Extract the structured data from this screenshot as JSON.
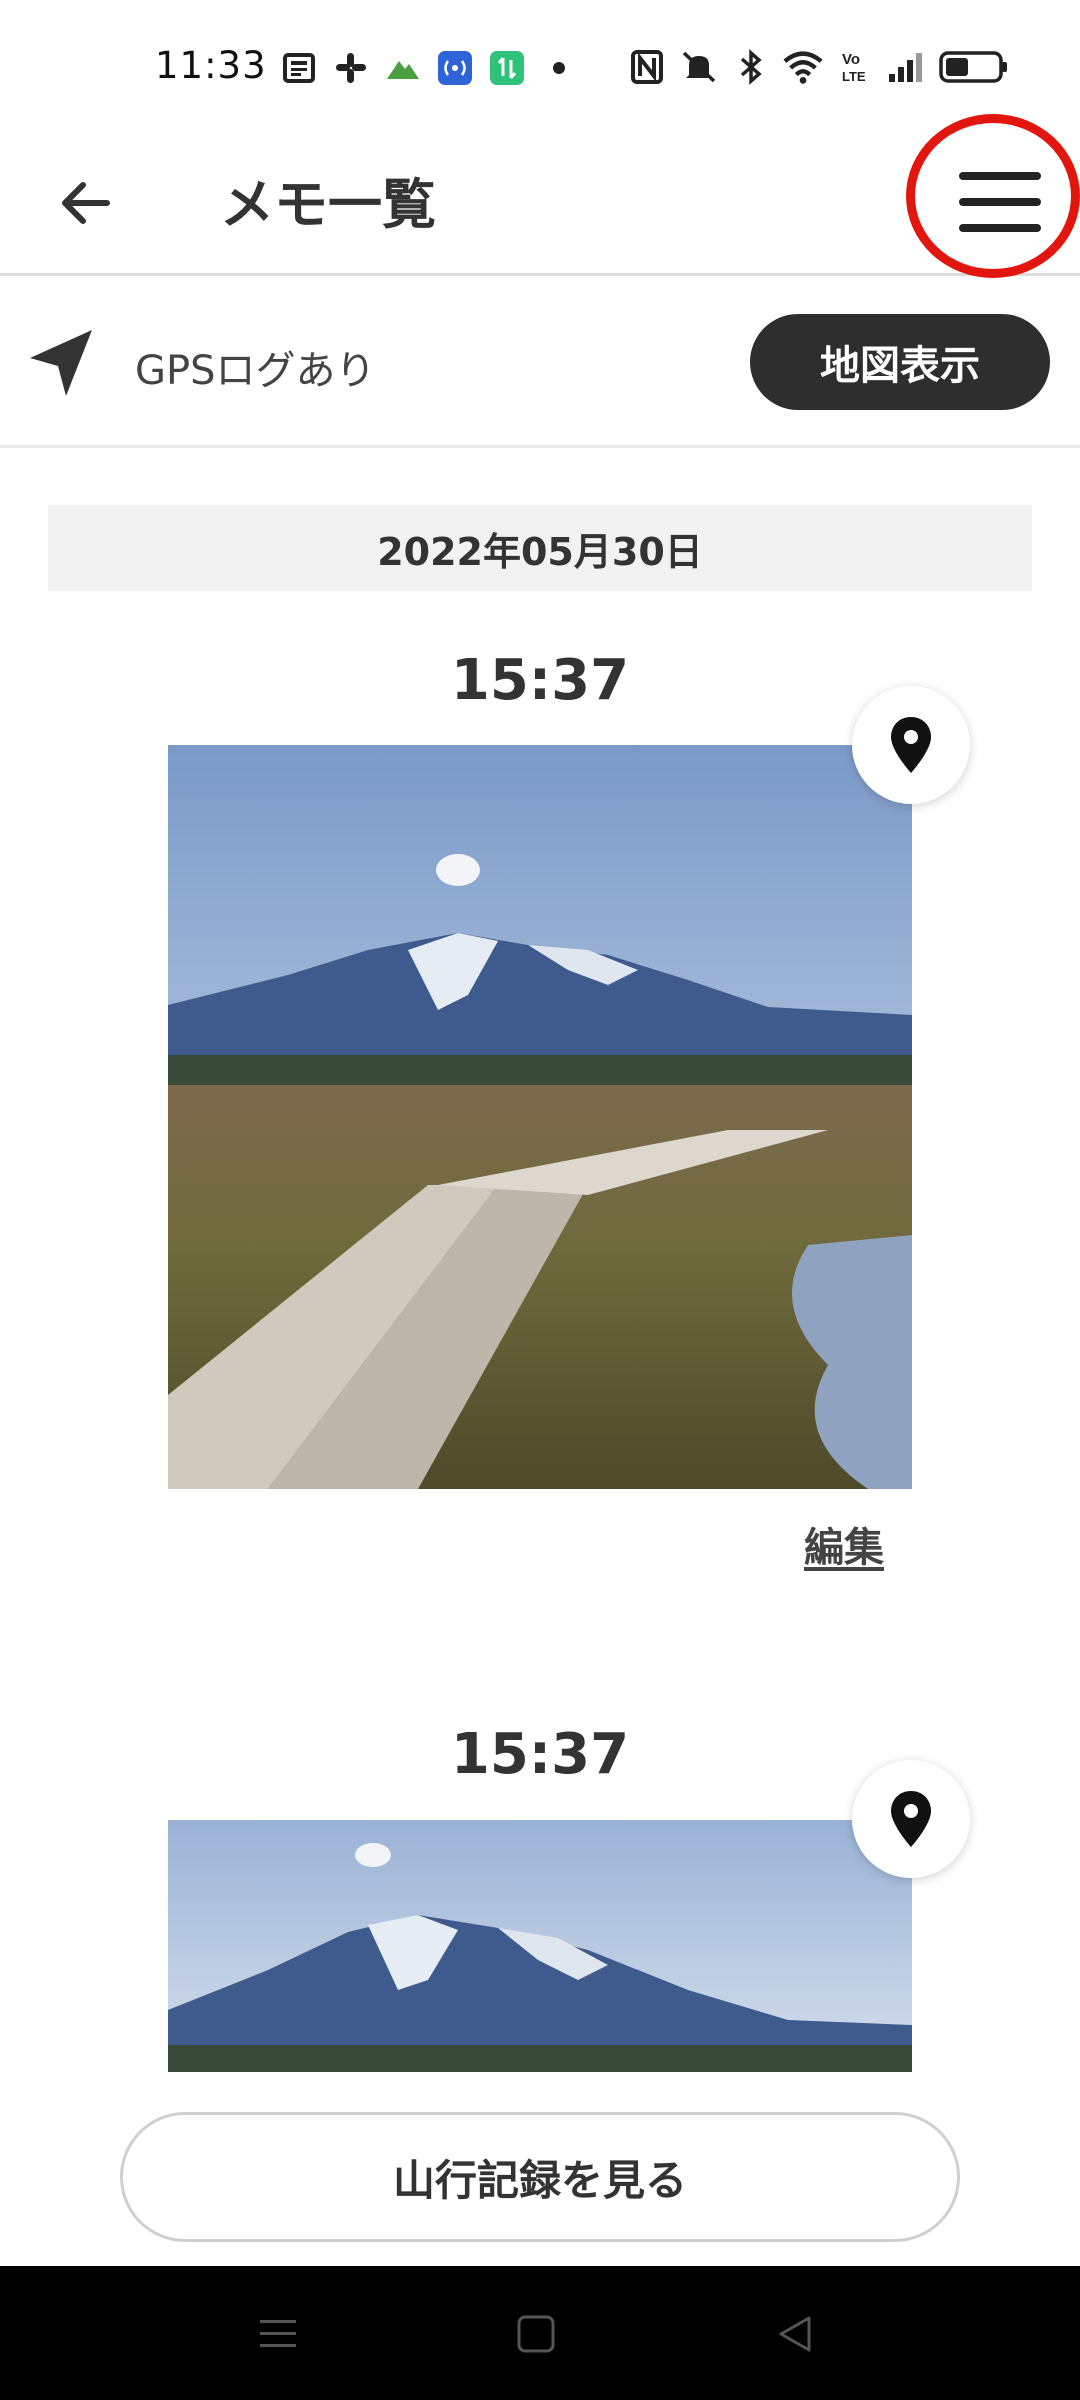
{
  "status_bar": {
    "time": "11:33",
    "icons": [
      "news-icon",
      "slack-icon",
      "mountain-icon",
      "radio-icon",
      "sync-icon",
      "dot-icon",
      "nfc-icon",
      "mute-icon",
      "bluetooth-icon",
      "wifi-icon",
      "volte-icon",
      "signal-icon",
      "battery-icon"
    ],
    "volte_text": "Vo\nLTE"
  },
  "header": {
    "title": "メモ一覧",
    "highlight_color": "#e3160f"
  },
  "gps": {
    "label": "GPSログあり",
    "map_button": "地図表示"
  },
  "date": "2022年05月30日",
  "memos": [
    {
      "time": "15:37",
      "edit_label": "編集"
    },
    {
      "time": "15:37"
    }
  ],
  "footer": {
    "record_button": "山行記録を見る"
  },
  "colors": {
    "dark_button": "#2e2e2e",
    "text": "#333333",
    "date_bg": "#f2f2f2"
  }
}
